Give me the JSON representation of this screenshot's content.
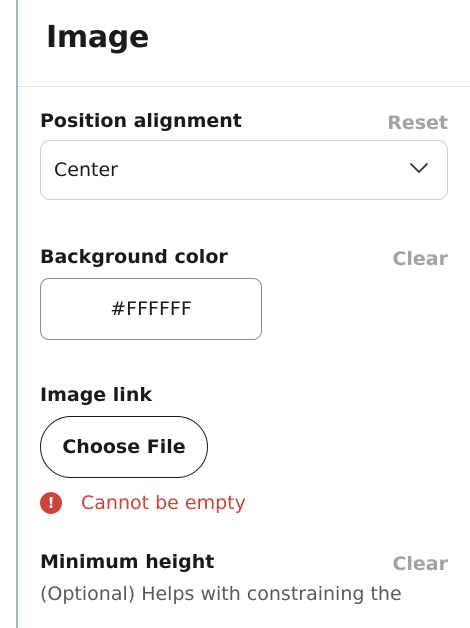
{
  "panel": {
    "title": "Image"
  },
  "position_alignment": {
    "label": "Position alignment",
    "reset_label": "Reset",
    "selected": "Center",
    "icon": "chevron-down-icon"
  },
  "background_color": {
    "label": "Background color",
    "clear_label": "Clear",
    "value": "#FFFFFF"
  },
  "image_link": {
    "label": "Image link",
    "button_label": "Choose File",
    "error_icon": "exclamation-icon",
    "error_text": "Cannot be empty",
    "error_color": "#c8453a"
  },
  "minimum_height": {
    "label": "Minimum height",
    "clear_label": "Clear",
    "help_text": "(Optional) Helps with constraining the"
  },
  "colors": {
    "accent_border": "#9fbad3",
    "muted_action": "#a3a3a3",
    "error": "#c8453a"
  }
}
